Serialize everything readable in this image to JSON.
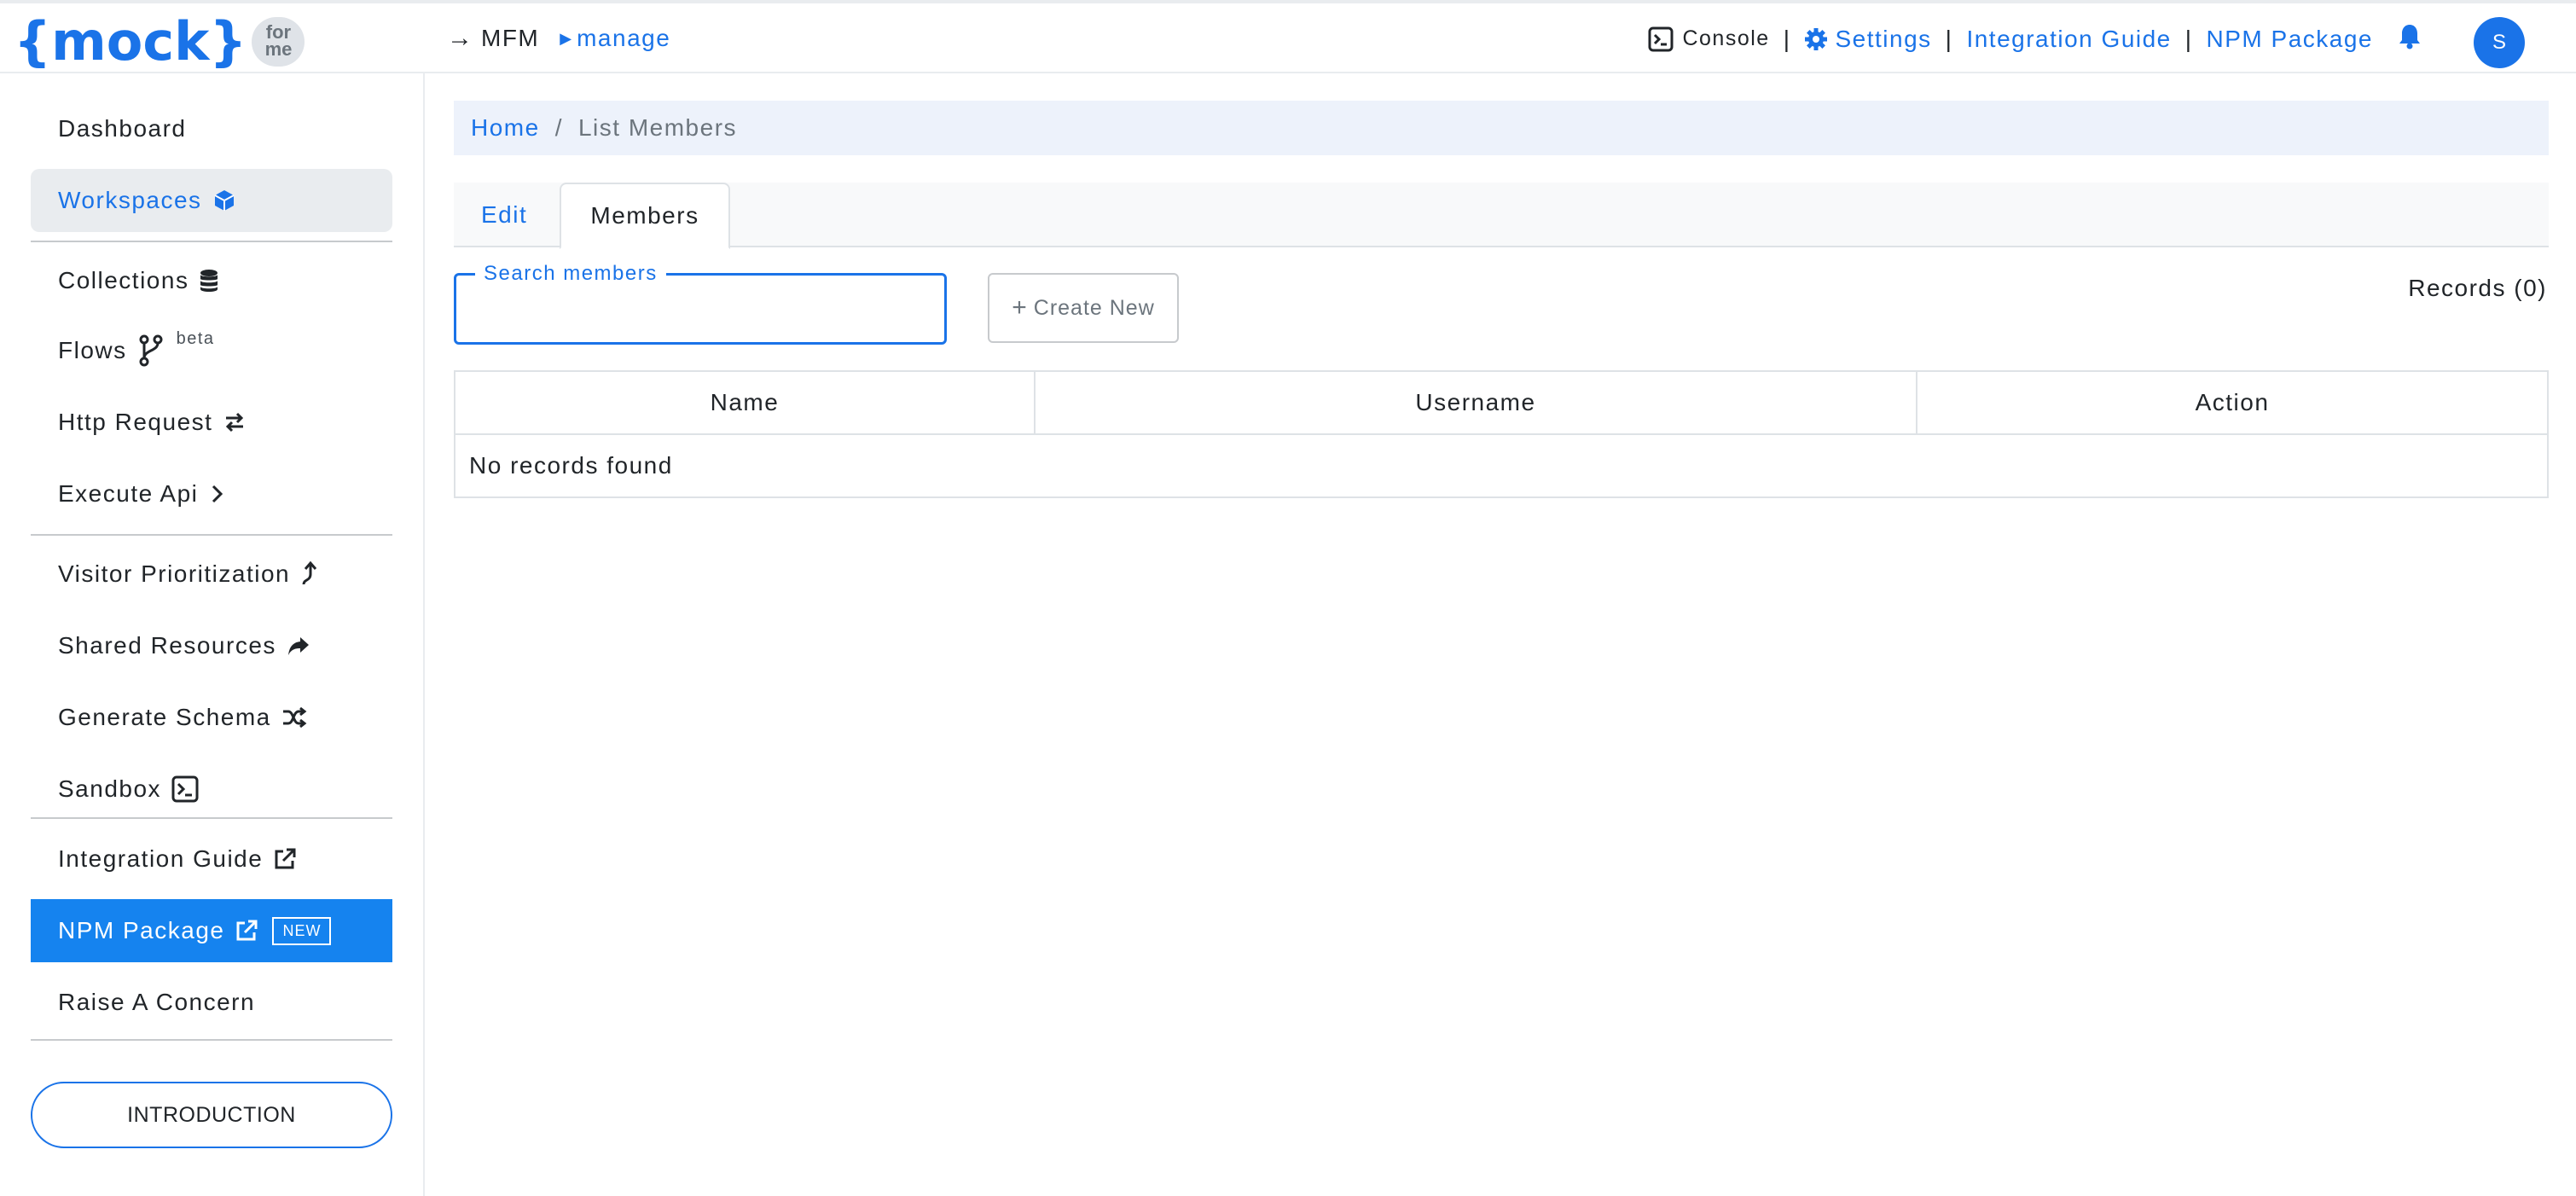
{
  "header": {
    "logo_text": "{mock}",
    "logo_badge_line1": "for",
    "logo_badge_line2": "me",
    "nav_arrow": "→",
    "project": "MFM",
    "section": "manage",
    "console_label": "Console",
    "settings_label": "Settings",
    "integration_guide_label": "Integration Guide",
    "npm_package_label": "NPM Package",
    "separator": "|",
    "avatar_initial": "S"
  },
  "sidebar": {
    "items": [
      {
        "label": "Dashboard"
      },
      {
        "label": "Workspaces"
      },
      {
        "label": "Collections"
      },
      {
        "label": "Flows",
        "badge": "beta"
      },
      {
        "label": "Http Request"
      },
      {
        "label": "Execute Api"
      },
      {
        "label": "Visitor Prioritization"
      },
      {
        "label": "Shared Resources"
      },
      {
        "label": "Generate Schema"
      },
      {
        "label": "Sandbox"
      },
      {
        "label": "Integration Guide"
      },
      {
        "label": "NPM Package",
        "badge": "NEW"
      },
      {
        "label": "Raise A Concern"
      }
    ],
    "intro_button": "INTRODUCTION"
  },
  "breadcrumb": {
    "home": "Home",
    "separator": "/",
    "current": "List Members"
  },
  "tabs": [
    {
      "label": "Edit"
    },
    {
      "label": "Members"
    }
  ],
  "search": {
    "label": "Search members",
    "value": ""
  },
  "create_button": {
    "icon": "+",
    "label": "Create New"
  },
  "records_label": "Records (0)",
  "table": {
    "columns": [
      "Name",
      "Username",
      "Action"
    ],
    "empty_message": "No records found"
  },
  "colors": {
    "accent": "#1a73e8",
    "active_bg": "#e9ecef",
    "highlight_bg": "#1583ef",
    "breadcrumb_bg": "#edf2fb"
  }
}
